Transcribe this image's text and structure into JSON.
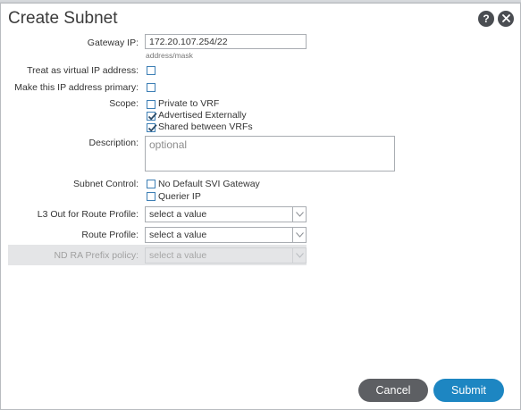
{
  "dialog": {
    "title": "Create Subnet",
    "help_icon": "question-icon",
    "close_icon": "close-icon"
  },
  "form": {
    "gateway_ip": {
      "label": "Gateway IP:",
      "value": "172.20.107.254/22",
      "hint": "address/mask"
    },
    "virtual_ip": {
      "label": "Treat as virtual IP address:",
      "checked": false
    },
    "primary_ip": {
      "label": "Make this IP address primary:",
      "checked": false
    },
    "scope": {
      "label": "Scope:",
      "options": [
        {
          "label": "Private to VRF",
          "checked": false
        },
        {
          "label": "Advertised Externally",
          "checked": true
        },
        {
          "label": "Shared between VRFs",
          "checked": true
        }
      ]
    },
    "description": {
      "label": "Description:",
      "placeholder": "optional"
    },
    "subnet_control": {
      "label": "Subnet Control:",
      "options": [
        {
          "label": "No Default SVI Gateway",
          "checked": false
        },
        {
          "label": "Querier IP",
          "checked": false
        }
      ]
    },
    "l3out_route_profile": {
      "label": "L3 Out for Route Profile:",
      "value": "select a value"
    },
    "route_profile": {
      "label": "Route Profile:",
      "value": "select a value"
    },
    "nd_ra_prefix_policy": {
      "label": "ND RA Prefix policy:",
      "value": "select a value",
      "disabled": true
    }
  },
  "footer": {
    "cancel_label": "Cancel",
    "submit_label": "Submit"
  },
  "colors": {
    "accent": "#1d86c2",
    "cancel": "#5d5f63",
    "checkbox_border": "#3d7fb5",
    "checkmark": "#2b4a66"
  }
}
